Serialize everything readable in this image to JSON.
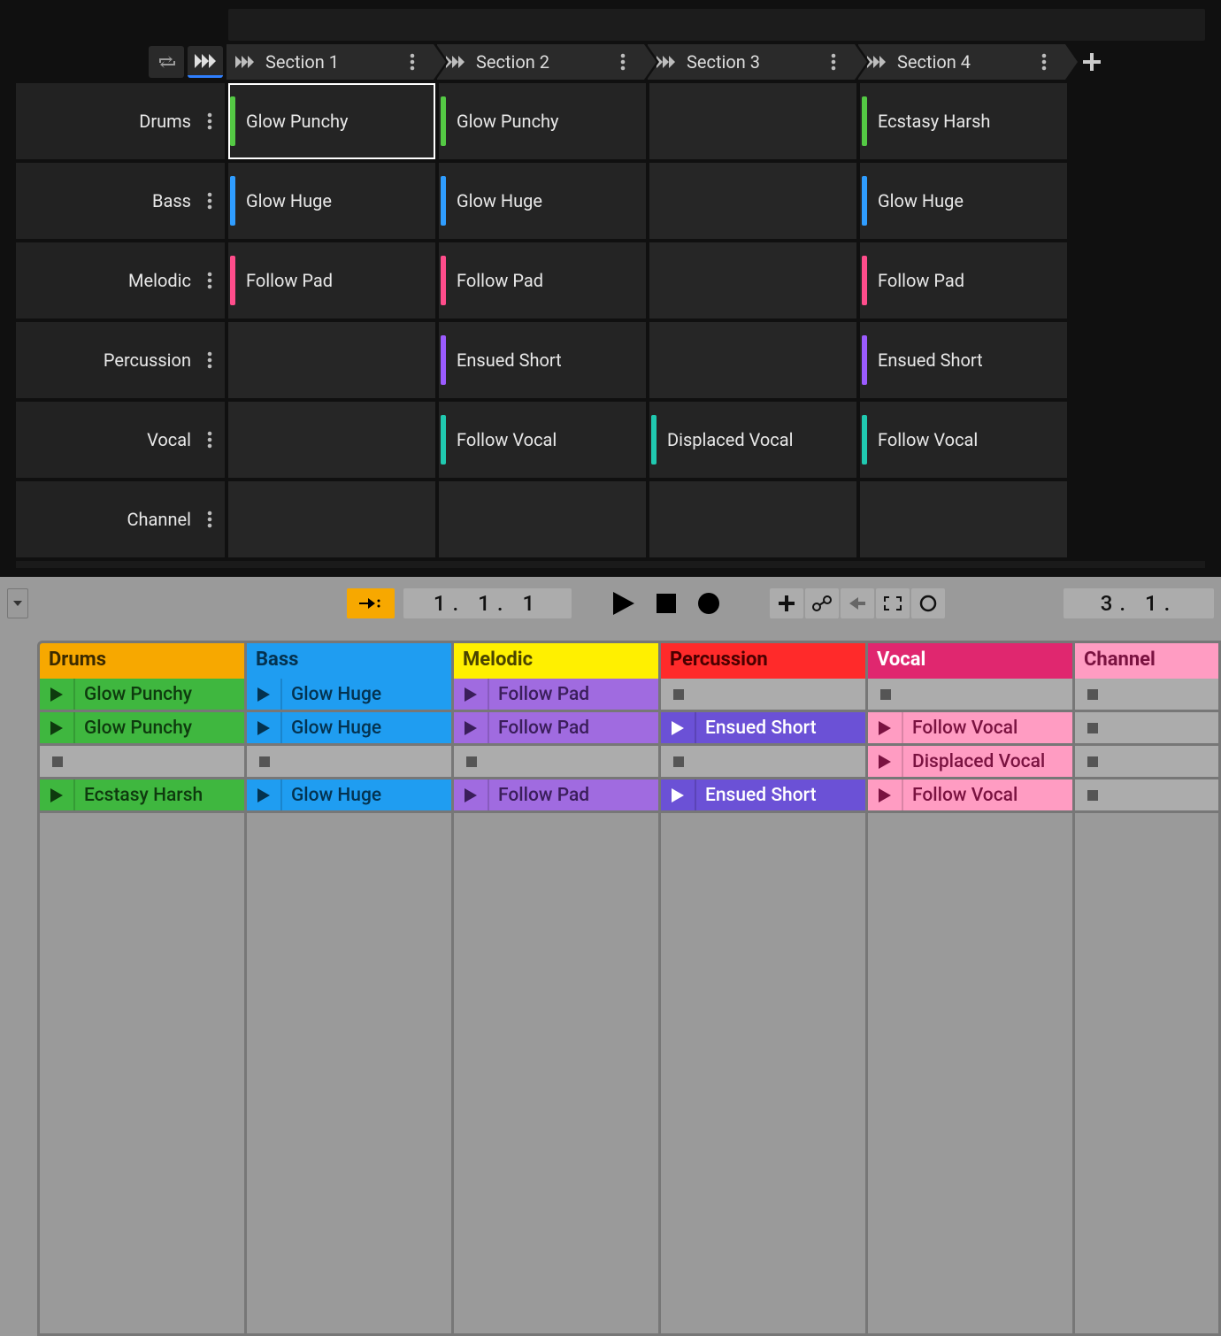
{
  "colors": {
    "green": "#54c944",
    "blue": "#2f9dff",
    "pink": "#ff4d8b",
    "purple": "#9b5bff",
    "teal": "#20c9b0",
    "orange": "#f7a800",
    "ablBlue": "#1f9df1",
    "ablYellow": "#fff000",
    "ablRed": "#ff2a2a",
    "ablMagenta": "#e0276f",
    "ablPink": "#ff9cc2",
    "ablGreen": "#3fb73f",
    "ablPurple": "#a06be0",
    "ablIndigo": "#6b51d6"
  },
  "dark": {
    "sections": [
      "Section 1",
      "Section 2",
      "Section 3",
      "Section 4"
    ],
    "tracks": [
      "Drums",
      "Bass",
      "Melodic",
      "Percussion",
      "Vocal",
      "Channel"
    ],
    "clips": [
      [
        {
          "t": "Glow Punchy",
          "c": "green",
          "sel": true
        },
        {
          "t": "Glow Punchy",
          "c": "green"
        },
        null,
        {
          "t": "Ecstasy Harsh",
          "c": "green"
        }
      ],
      [
        {
          "t": "Glow Huge",
          "c": "blue"
        },
        {
          "t": "Glow Huge",
          "c": "blue"
        },
        null,
        {
          "t": "Glow Huge",
          "c": "blue"
        }
      ],
      [
        {
          "t": "Follow Pad",
          "c": "pink"
        },
        {
          "t": "Follow Pad",
          "c": "pink"
        },
        null,
        {
          "t": "Follow Pad",
          "c": "pink"
        }
      ],
      [
        null,
        {
          "t": "Ensued Short",
          "c": "purple"
        },
        null,
        {
          "t": "Ensued Short",
          "c": "purple"
        }
      ],
      [
        null,
        {
          "t": "Follow Vocal",
          "c": "teal"
        },
        {
          "t": "Displaced Vocal",
          "c": "teal"
        },
        {
          "t": "Follow Vocal",
          "c": "teal"
        }
      ],
      [
        null,
        null,
        null,
        null
      ]
    ]
  },
  "transport": {
    "pos1": "1. 1. 1",
    "pos2": "3. 1."
  },
  "session": {
    "tracks": [
      {
        "name": "Drums",
        "hdr": "orange",
        "txt": "#3b2a00",
        "clip": "ablGreen",
        "playTri": "#0e3a0e",
        "lab": "#0e3a0e"
      },
      {
        "name": "Bass",
        "hdr": "ablBlue",
        "txt": "#04324f",
        "clip": "ablBlue",
        "playTri": "#04324f",
        "lab": "#04324f"
      },
      {
        "name": "Melodic",
        "hdr": "ablYellow",
        "txt": "#4a4400",
        "clip": "ablPurple",
        "playTri": "#3a1e5a",
        "lab": "#3a1e5a"
      },
      {
        "name": "Percussion",
        "hdr": "ablRed",
        "txt": "#4a0000",
        "clip": "ablIndigo",
        "playTri": "#ffffff",
        "lab": "#ffffff"
      },
      {
        "name": "Vocal",
        "hdr": "ablMagenta",
        "txt": "#ffffff",
        "clip": "ablPink",
        "playTri": "#7a1240",
        "lab": "#7a1240"
      },
      {
        "name": "Channel",
        "hdr": "ablPink",
        "txt": "#7a1240",
        "clip": "ablPink",
        "playTri": "#7a1240",
        "lab": "#7a1240"
      }
    ],
    "rows": [
      [
        {
          "t": "Glow Punchy"
        },
        {
          "t": "Glow Huge"
        },
        {
          "t": "Follow Pad"
        },
        {
          "stop": true
        },
        {
          "stop": true
        },
        {
          "stop": true
        }
      ],
      [
        {
          "t": "Glow Punchy"
        },
        {
          "t": "Glow Huge"
        },
        {
          "t": "Follow Pad"
        },
        {
          "t": "Ensued Short"
        },
        {
          "t": "Follow Vocal"
        },
        {
          "stop": true
        }
      ],
      [
        {
          "stop": true
        },
        {
          "stop": true
        },
        {
          "stop": true
        },
        {
          "stop": true
        },
        {
          "t": "Displaced Vocal"
        },
        {
          "stop": true
        }
      ],
      [
        {
          "t": "Ecstasy Harsh"
        },
        {
          "t": "Glow Huge"
        },
        {
          "t": "Follow Pad"
        },
        {
          "t": "Ensued Short"
        },
        {
          "t": "Follow Vocal"
        },
        {
          "stop": true
        }
      ]
    ]
  }
}
